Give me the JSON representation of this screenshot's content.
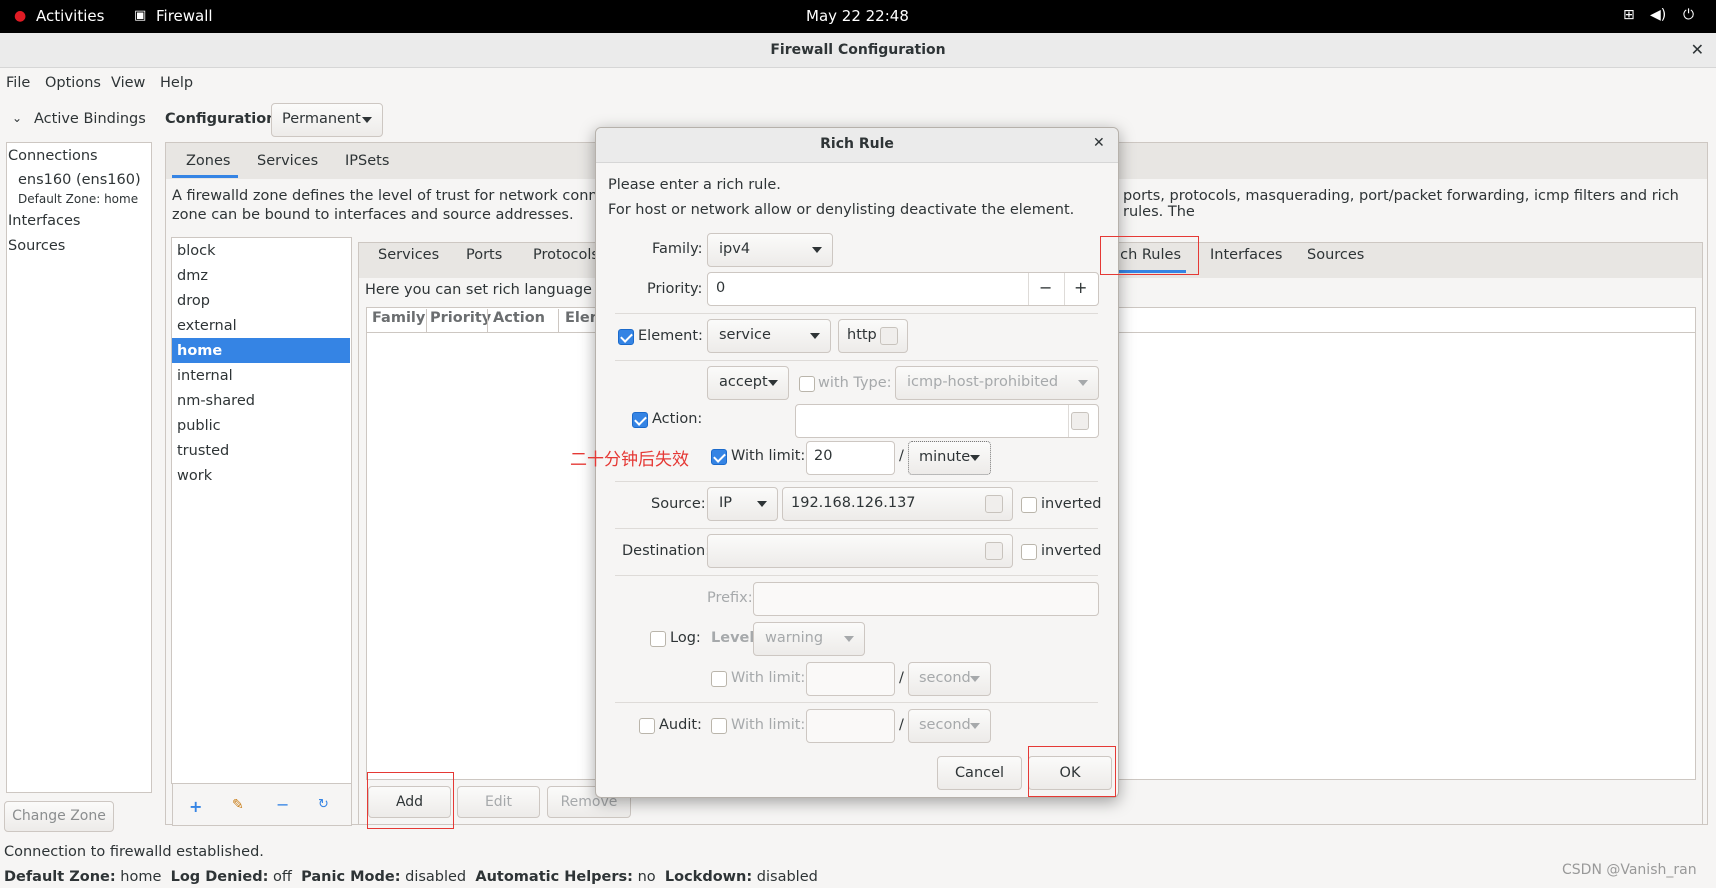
{
  "topbar": {
    "activities": "Activities",
    "app": "Firewall",
    "datetime": "May 22  22:48"
  },
  "window": {
    "title": "Firewall Configuration"
  },
  "menu": [
    "File",
    "Options",
    "View",
    "Help"
  ],
  "sidebar": {
    "active_bindings": "Active Bindings",
    "connections": "Connections",
    "connection_name": "ens160 (ens160)",
    "connection_zone": "Default Zone: home",
    "interfaces": "Interfaces",
    "sources": "Sources",
    "change_zone": "Change Zone"
  },
  "config": {
    "label": "Configuration:",
    "value": "Permanent"
  },
  "main_tabs": [
    "Zones",
    "Services",
    "IPSets"
  ],
  "zone_desc": "A firewalld zone defines the level of trust for network connections, interfaces and source addresses bound to the zone. The zone combines services, ports, protocols, masquerading, port/packet forwarding, icmp filters and rich rules. The zone can be bound to interfaces and source addresses.",
  "zone_desc_left1": "A firewalld zone defines the level of trust for network connections",
  "zone_desc_left2": "zone can be bound to interfaces and source addresses.",
  "zone_desc_right": "ports, protocols, masquerading, port/packet forwarding, icmp filters and rich rules. The",
  "zones": [
    "block",
    "dmz",
    "drop",
    "external",
    "home",
    "internal",
    "nm-shared",
    "public",
    "trusted",
    "work"
  ],
  "selected_zone": "home",
  "sub_tabs": [
    "Services",
    "Ports",
    "Protocols",
    "Rich Rules",
    "Interfaces",
    "Sources"
  ],
  "rich_rules": {
    "hint": "Here you can set rich language rules",
    "columns": [
      "Family",
      "Priority",
      "Action",
      "Elem"
    ],
    "add": "Add",
    "edit": "Edit",
    "remove": "Remove"
  },
  "status": {
    "message": "Connection to firewalld established.",
    "default_zone_label": "Default Zone:",
    "default_zone": "home",
    "log_denied_label": "Log Denied:",
    "log_denied": "off",
    "panic_label": "Panic Mode:",
    "panic": "disabled",
    "helpers_label": "Automatic Helpers:",
    "helpers": "no",
    "lockdown_label": "Lockdown:",
    "lockdown": "disabled"
  },
  "watermark": "CSDN @Vanish_ran",
  "annotation": "二十分钟后失效",
  "dialog": {
    "title": "Rich Rule",
    "intro1": "Please enter a rich rule.",
    "intro2": "For host or network allow or denylisting deactivate the element.",
    "family_label": "Family:",
    "family": "ipv4",
    "priority_label": "Priority:",
    "priority": "0",
    "element_label": "Element:",
    "element_type": "service",
    "element_value": "http",
    "element_checked": true,
    "action_value": "accept",
    "with_type_label": "with Type:",
    "with_type": "icmp-host-prohibited",
    "action_label": "Action:",
    "action_checked": true,
    "with_limit_label": "With limit:",
    "limit_value": "20",
    "slash": "/",
    "limit_unit": "minute",
    "source_label": "Source:",
    "source_type": "IP",
    "source_value": "192.168.126.137",
    "inverted": "inverted",
    "destination_label": "Destination:",
    "prefix_label": "Prefix:",
    "log_label": "Log:",
    "level_label": "Level:",
    "level": "warning",
    "log_limit_unit": "second",
    "audit_label": "Audit:",
    "audit_limit_unit": "second",
    "cancel": "Cancel",
    "ok": "OK"
  },
  "colors": {
    "accent": "#3584e4",
    "highlight_box": "#e53935",
    "selected_row": "#3584e4"
  }
}
